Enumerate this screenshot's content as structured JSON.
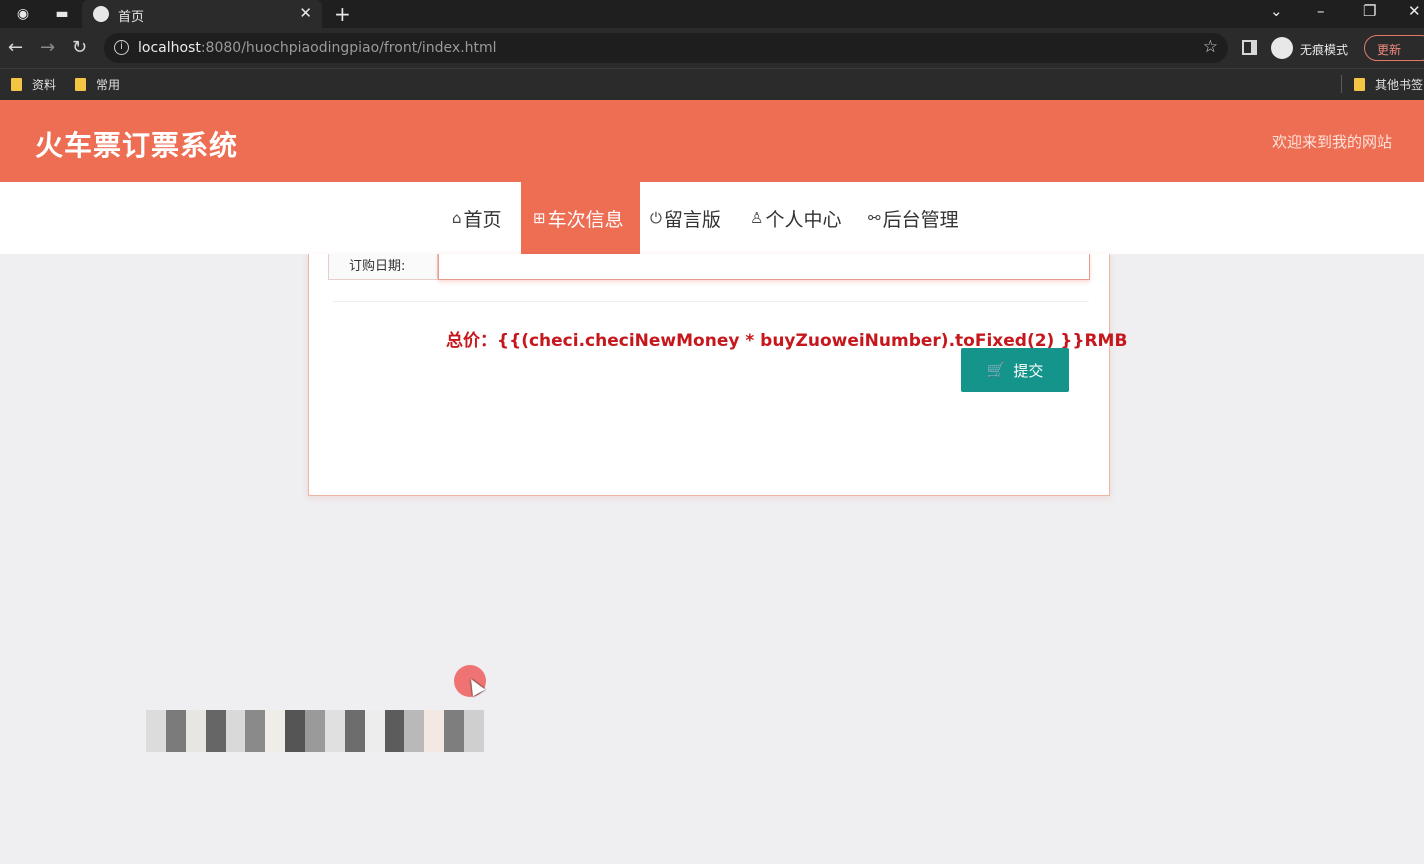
{
  "browser": {
    "tab_title": "首页",
    "url_host": "localhost",
    "url_rest": ":8080/huochpiaodingpiao/front/index.html",
    "incognito_label": "无痕模式",
    "update_label": "更新",
    "bookmarks": [
      "资料",
      "常用"
    ],
    "other_bookmarks": "其他书签"
  },
  "site": {
    "title": "火车票订票系统",
    "welcome": "欢迎来到我的网站",
    "nav": [
      {
        "icon": "home-icon",
        "label": "首页"
      },
      {
        "icon": "gift-icon",
        "label": "车次信息",
        "active": true
      },
      {
        "icon": "power-icon",
        "label": "留言版"
      },
      {
        "icon": "user-icon",
        "label": "个人中心"
      },
      {
        "icon": "link-icon",
        "label": "后台管理"
      }
    ]
  },
  "form": {
    "date_label": "订购日期:",
    "date_value": "",
    "total_text": "总价：{{(checi.checiNewMoney * buyZuoweiNumber).toFixed(2) }}RMB",
    "submit_label": "提交"
  },
  "colors": {
    "header": "#ee6e54",
    "submit": "#14948a",
    "total": "#c6171d"
  }
}
